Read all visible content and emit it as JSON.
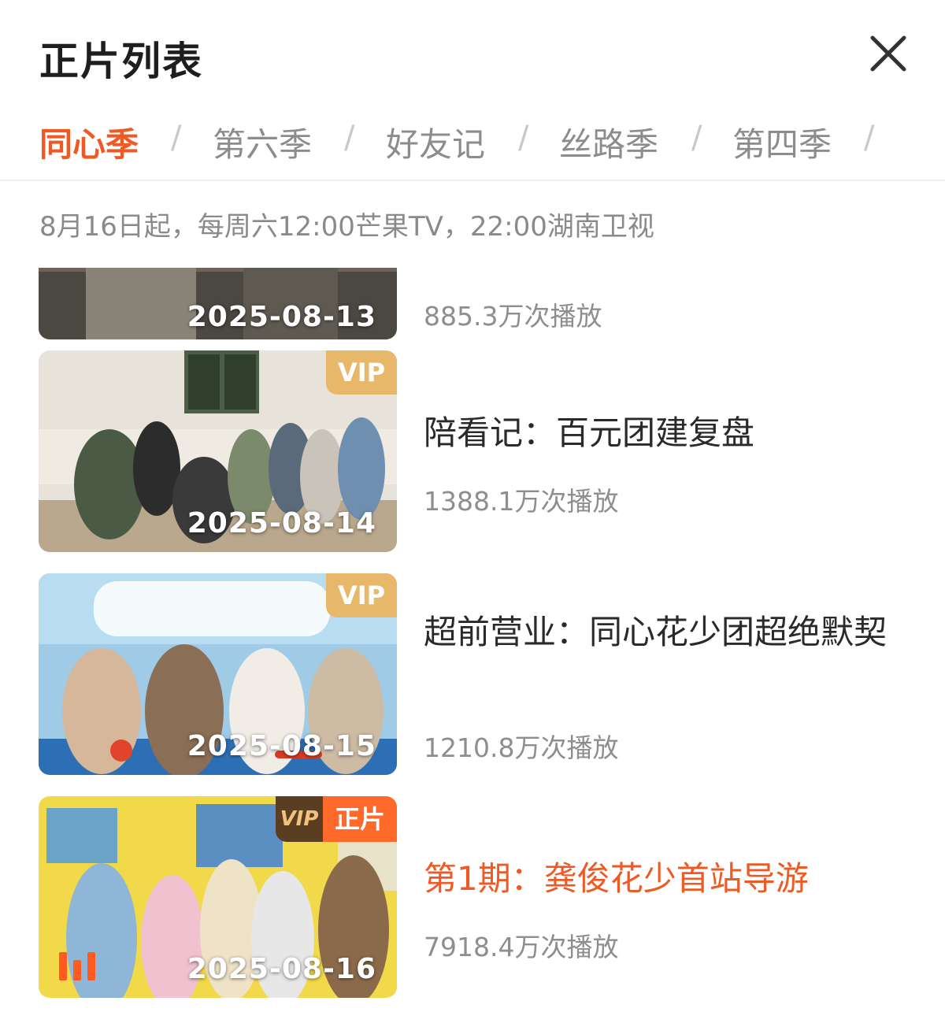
{
  "header": {
    "title": "正片列表"
  },
  "tabs": [
    {
      "label": "同心季"
    },
    {
      "label": "第六季"
    },
    {
      "label": "好友记"
    },
    {
      "label": "丝路季"
    },
    {
      "label": "第四季"
    }
  ],
  "tab_separator": "/",
  "schedule": "8月16日起，每周六12:00芒果TV，22:00湖南卫视",
  "episodes": [
    {
      "date": "2025-08-13",
      "title": "",
      "views": "885.3万次播放",
      "badge": ""
    },
    {
      "date": "2025-08-14",
      "title": "陪看记：百元团建复盘",
      "views": "1388.1万次播放",
      "badge": "VIP"
    },
    {
      "date": "2025-08-15",
      "title": "超前营业：同心花少团超绝默契",
      "views": "1210.8万次播放",
      "badge": "VIP"
    },
    {
      "date": "2025-08-16",
      "title": "第1期：龚俊花少首站导游",
      "views": "7918.4万次播放",
      "badge_vip": "VIP",
      "badge_label": "正片"
    }
  ],
  "colors": {
    "accent": "#ef5a24",
    "vip_badge": "#e8b86a",
    "zhengpian_badge": "#ff6a2b"
  }
}
